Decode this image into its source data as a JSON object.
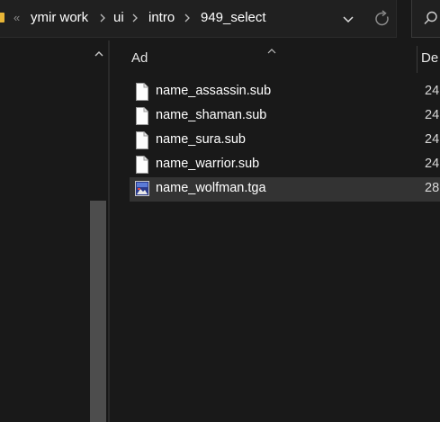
{
  "address_bar": {
    "overflow_glyph": "«",
    "crumbs": [
      "ymir work",
      "ui",
      "intro",
      "949_select"
    ],
    "icons": {
      "folder": "folder-icon",
      "separator": "chevron-right-icon",
      "dropdown": "chevron-down-icon",
      "refresh": "refresh-icon",
      "search": "search-icon"
    }
  },
  "nav_pane": {
    "partial_glyph": ":"
  },
  "columns": {
    "name": "Ad",
    "date": "De"
  },
  "files": [
    {
      "name": "name_assassin.sub",
      "date": "24",
      "icon": "document-icon",
      "selected": false
    },
    {
      "name": "name_shaman.sub",
      "date": "24",
      "icon": "document-icon",
      "selected": false
    },
    {
      "name": "name_sura.sub",
      "date": "24",
      "icon": "document-icon",
      "selected": false
    },
    {
      "name": "name_warrior.sub",
      "date": "24",
      "icon": "document-icon",
      "selected": false
    },
    {
      "name": "name_wolfman.tga",
      "date": "28",
      "icon": "image-file-icon",
      "selected": true
    }
  ],
  "colors": {
    "background": "#191919",
    "selection": "#333333",
    "folder_accent": "#e8b537"
  }
}
